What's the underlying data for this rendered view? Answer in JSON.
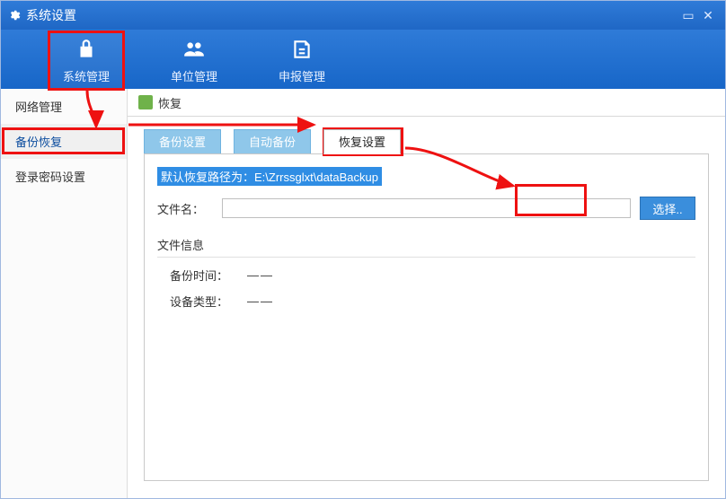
{
  "window": {
    "title": "系统设置"
  },
  "toolbar": {
    "items": [
      {
        "label": "系统管理"
      },
      {
        "label": "单位管理"
      },
      {
        "label": "申报管理"
      }
    ]
  },
  "sidebar": {
    "items": [
      {
        "label": "网络管理"
      },
      {
        "label": "备份恢复"
      },
      {
        "label": "登录密码设置"
      }
    ]
  },
  "breadcrumb": {
    "label": "恢复"
  },
  "tabs": {
    "items": [
      {
        "label": "备份设置"
      },
      {
        "label": "自动备份"
      },
      {
        "label": "恢复设置"
      }
    ]
  },
  "panel": {
    "hint": "默认恢复路径为：E:\\Zrrssglxt\\dataBackup",
    "file_label": "文件名：",
    "file_value": "",
    "choose_label": "选择..",
    "info_title": "文件信息",
    "rows": [
      {
        "k": "备份时间：",
        "v": "——"
      },
      {
        "k": "设备类型：",
        "v": "——"
      }
    ]
  }
}
